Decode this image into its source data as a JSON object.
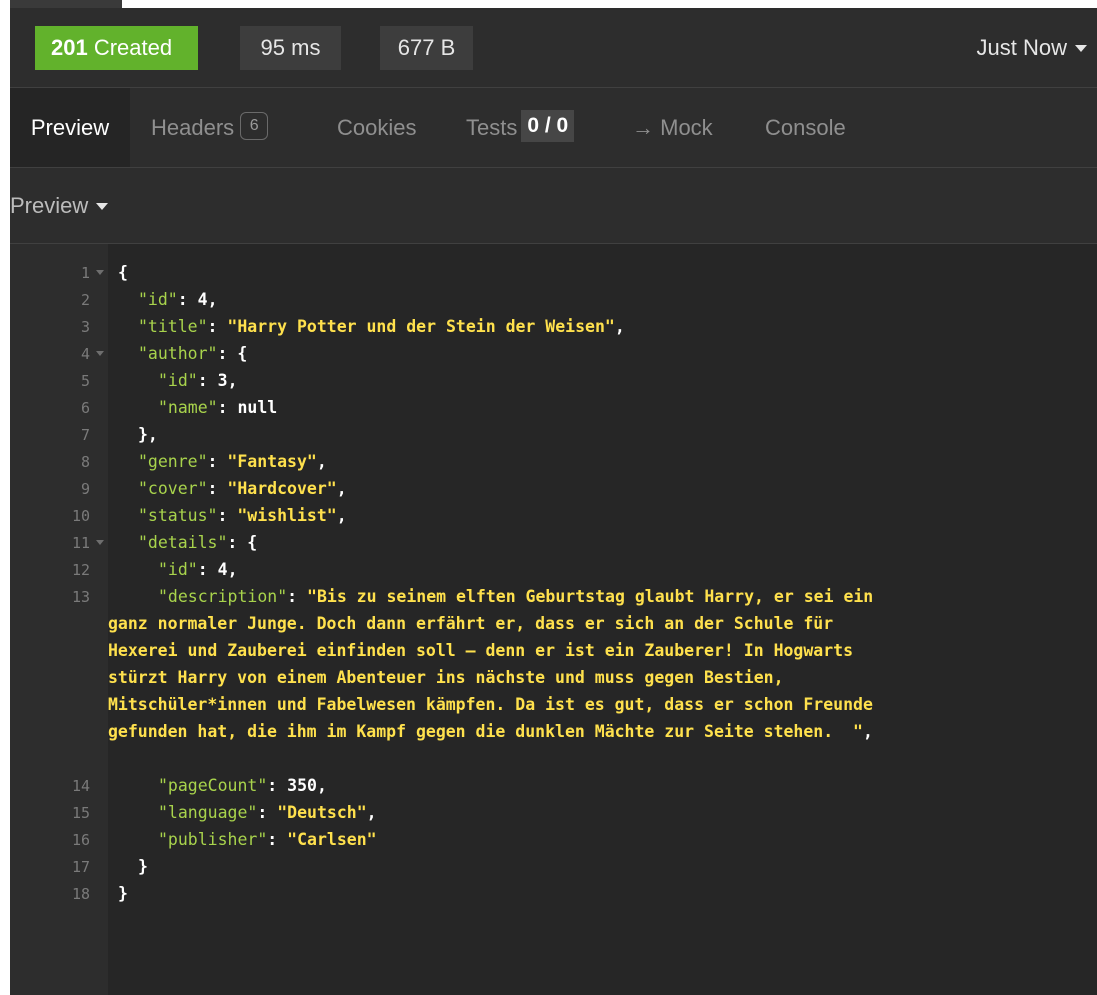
{
  "status": {
    "code": "201",
    "text": "Created",
    "time": "95 ms",
    "size": "677 B",
    "timestamp": "Just Now"
  },
  "tabs": {
    "preview": "Preview",
    "headers": "Headers",
    "headers_count": "6",
    "cookies": "Cookies",
    "tests": "Tests",
    "tests_count": "0 / 0",
    "mock": "→ Mock",
    "console": "Console"
  },
  "preview_mode": "Preview",
  "line_numbers": [
    "1",
    "2",
    "3",
    "4",
    "5",
    "6",
    "7",
    "8",
    "9",
    "10",
    "11",
    "12",
    "13",
    "14",
    "15",
    "16",
    "17",
    "18"
  ],
  "json": {
    "k_id": "\"id\"",
    "v_id": "4",
    "k_title": "\"title\"",
    "v_title": "\"Harry Potter und der Stein der Weisen\"",
    "k_author": "\"author\"",
    "k_author_id": "\"id\"",
    "v_author_id": "3",
    "k_author_name": "\"name\"",
    "v_author_name": "null",
    "k_genre": "\"genre\"",
    "v_genre": "\"Fantasy\"",
    "k_cover": "\"cover\"",
    "v_cover": "\"Hardcover\"",
    "k_status": "\"status\"",
    "v_status": "\"wishlist\"",
    "k_details": "\"details\"",
    "k_details_id": "\"id\"",
    "v_details_id": "4",
    "k_description": "\"description\"",
    "v_description_lines": [
      "\"Bis zu seinem elften Geburtstag glaubt Harry, er sei ein",
      "ganz normaler Junge. Doch dann erfährt er, dass er sich an der Schule für",
      "Hexerei und Zauberei einfinden soll – denn er ist ein Zauberer! In Hogwarts",
      "stürzt Harry von einem Abenteuer ins nächste und muss gegen Bestien,",
      "Mitschüler*innen und Fabelwesen kämpfen. Da ist es gut, dass er schon Freunde",
      "gefunden hat, die ihm im Kampf gegen die dunklen Mächte zur Seite stehen.  \""
    ],
    "k_pagecount": "\"pageCount\"",
    "v_pagecount": "350",
    "k_language": "\"language\"",
    "v_language": "\"Deutsch\"",
    "k_publisher": "\"publisher\"",
    "v_publisher": "\"Carlsen\""
  }
}
